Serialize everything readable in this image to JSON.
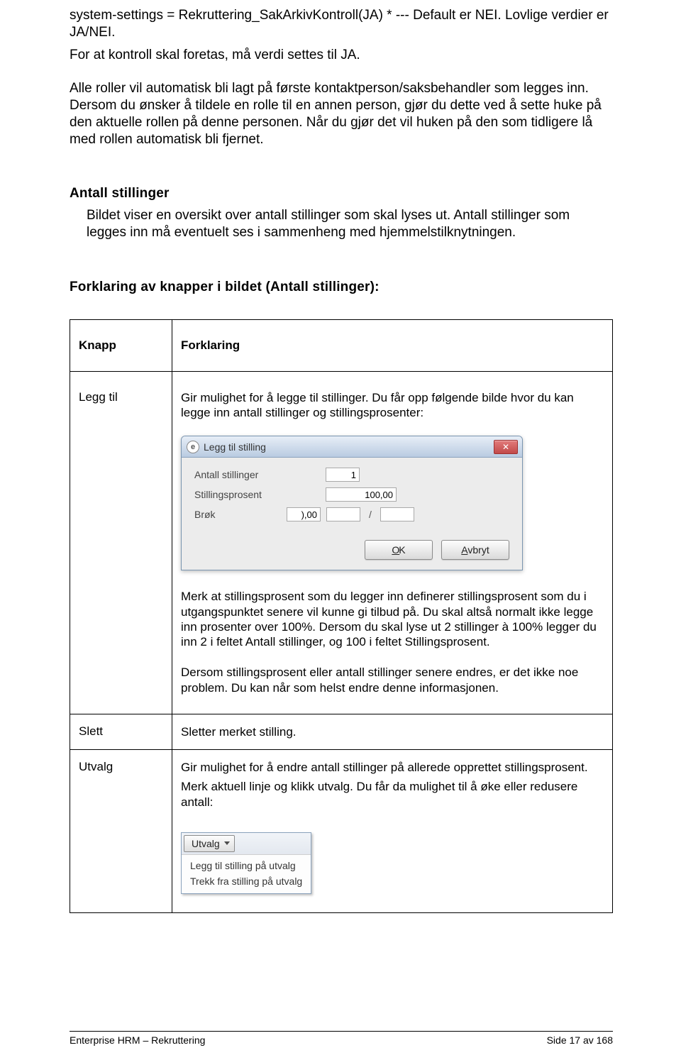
{
  "intro": {
    "p1": "system-settings = Rekruttering_SakArkivKontroll(JA) * --- Default er NEI. Lovlige verdier er JA/NEI.",
    "p2": "For at kontroll skal foretas, må verdi settes til JA.",
    "p3": "Alle roller vil automatisk bli lagt på første kontaktperson/saksbehandler som legges inn. Dersom du ønsker å tildele en rolle til en annen person, gjør du dette ved å sette huke på den aktuelle rollen på denne personen. Når du gjør det vil huken på den som tidligere lå med rollen automatisk bli fjernet."
  },
  "heading_antall": "Antall stillinger",
  "antall_body": "Bildet viser en oversikt over antall stillinger som skal lyses ut. Antall stillinger som legges inn må eventuelt ses i sammenheng med hjemmelstilknytningen.",
  "heading_forklaring": "Forklaring av knapper i bildet (Antall stillinger):",
  "table": {
    "header_knapp": "Knapp",
    "header_forklaring": "Forklaring",
    "rows": {
      "leggtil": {
        "knapp": "Legg til",
        "p1": "Gir mulighet for å legge til stillinger. Du får opp følgende bilde hvor du kan legge inn antall stillinger og stillingsprosenter:",
        "p2": "Merk at stillingsprosent som du legger inn definerer stillingsprosent som du i utgangspunktet senere vil kunne gi tilbud på. Du skal altså normalt ikke legge inn prosenter over 100%. Dersom du skal lyse ut 2 stillinger à 100% legger du inn 2 i feltet Antall stillinger, og 100 i feltet Stillingsprosent.",
        "p3": "Dersom stillingsprosent eller antall stillinger senere endres, er det ikke noe problem. Du kan når som helst endre denne informasjonen."
      },
      "slett": {
        "knapp": "Slett",
        "p1": "Sletter merket stilling."
      },
      "utvalg": {
        "knapp": "Utvalg",
        "p1": "Gir mulighet for å endre antall stillinger på allerede opprettet stillingsprosent.",
        "p2": "Merk aktuell linje og klikk utvalg. Du får da mulighet til å øke eller redusere antall:"
      }
    }
  },
  "dialog": {
    "title": "Legg til stilling",
    "labels": {
      "antall": "Antall stillinger",
      "prosent": "Stillingsprosent",
      "brok": "Brøk"
    },
    "values": {
      "antall": "1",
      "prosent": "100,00",
      "brok_a": "),00",
      "brok_b": "",
      "brok_c": ""
    },
    "buttons": {
      "ok": "OK",
      "avbryt": "Avbryt"
    }
  },
  "dropdown": {
    "button": "Utvalg",
    "items": [
      "Legg til stilling på utvalg",
      "Trekk fra stilling på utvalg"
    ]
  },
  "footer": {
    "left": "Enterprise HRM – Rekruttering",
    "right": "Side 17 av 168"
  }
}
